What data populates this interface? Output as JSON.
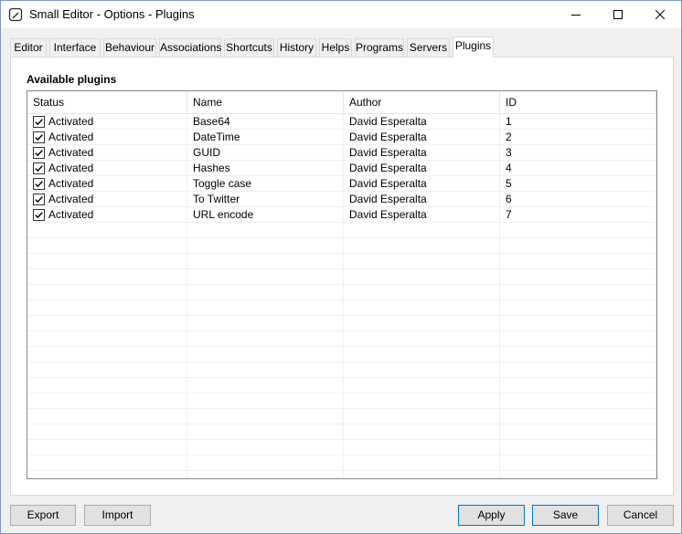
{
  "window": {
    "title": "Small Editor - Options - Plugins"
  },
  "tabs": [
    {
      "label": "Editor"
    },
    {
      "label": "Interface"
    },
    {
      "label": "Behaviour"
    },
    {
      "label": "Associations"
    },
    {
      "label": "Shortcuts"
    },
    {
      "label": "History"
    },
    {
      "label": "Helps"
    },
    {
      "label": "Programs"
    },
    {
      "label": "Servers"
    },
    {
      "label": "Plugins",
      "active": true
    }
  ],
  "plugins": {
    "section_label": "Available plugins",
    "columns": [
      "Status",
      "Name",
      "Author",
      "ID"
    ],
    "rows": [
      {
        "checked": true,
        "status": "Activated",
        "name": "Base64",
        "author": "David Esperalta",
        "id": "1"
      },
      {
        "checked": true,
        "status": "Activated",
        "name": "DateTime",
        "author": "David Esperalta",
        "id": "2"
      },
      {
        "checked": true,
        "status": "Activated",
        "name": "GUID",
        "author": "David Esperalta",
        "id": "3"
      },
      {
        "checked": true,
        "status": "Activated",
        "name": "Hashes",
        "author": "David Esperalta",
        "id": "4"
      },
      {
        "checked": true,
        "status": "Activated",
        "name": "Toggle case",
        "author": "David Esperalta",
        "id": "5"
      },
      {
        "checked": true,
        "status": "Activated",
        "name": "To Twitter",
        "author": "David Esperalta",
        "id": "6"
      },
      {
        "checked": true,
        "status": "Activated",
        "name": "URL encode",
        "author": "David Esperalta",
        "id": "7"
      }
    ]
  },
  "buttons": {
    "export": "Export",
    "import": "Import",
    "apply": "Apply",
    "save": "Save",
    "cancel": "Cancel"
  },
  "colors": {
    "accent": "#0078d7",
    "window_border": "#7a9cc6"
  }
}
